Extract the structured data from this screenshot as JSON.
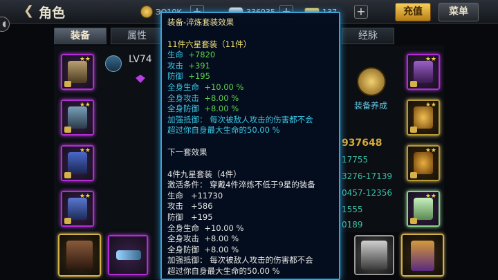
{
  "header": {
    "title": "角色",
    "currencies": [
      {
        "name": "copper-coin",
        "value": "ЭО10К"
      },
      {
        "name": "silver",
        "value": "336935"
      },
      {
        "name": "gold",
        "value": "137"
      }
    ],
    "recharge_label": "充值",
    "menu_label": "菜单"
  },
  "tabs": [
    "装备",
    "属性",
    "经脉"
  ],
  "hero": {
    "level": "LV74"
  },
  "side_panel": {
    "cultivate_label": "装备养成",
    "power": "937648",
    "stats": [
      "17755",
      "3276-17139",
      "0457-12356",
      "1555",
      "0189"
    ]
  },
  "tooltip": {
    "title": "装备-淬炼套装效果",
    "current": {
      "set_name": "11件六星套装（11件）",
      "stats": [
        {
          "label": "生命",
          "value": "+7820"
        },
        {
          "label": "攻击",
          "value": "+391"
        },
        {
          "label": "防御",
          "value": "+195"
        },
        {
          "label": "全身生命",
          "value": "+10.00 %"
        },
        {
          "label": "全身攻击",
          "value": "+8.00 %"
        },
        {
          "label": "全身防御",
          "value": "+8.00 %"
        }
      ],
      "special_label": "加强抵御：",
      "special_text_1": "每次被敌人攻击的伤害都不会",
      "special_text_2": "超过你自身最大生命的50.00 %"
    },
    "next_header": "下一套效果",
    "next": {
      "set_name": "4件九星套装（4件）",
      "condition_label": "激活条件：",
      "condition": "穿戴4件淬炼不低于9星的装备",
      "stats": [
        {
          "label": "生命",
          "value": "+11730"
        },
        {
          "label": "攻击",
          "value": "+586"
        },
        {
          "label": "防御",
          "value": "+195"
        },
        {
          "label": "全身生命",
          "value": "+10.00 %"
        },
        {
          "label": "全身攻击",
          "value": "+8.00 %"
        },
        {
          "label": "全身防御",
          "value": "+8.00 %"
        }
      ],
      "special_label": "加强抵御：",
      "special_text_1": "每次被敌人攻击的伤害都不会",
      "special_text_2": "超过你自身最大生命的50.00 %"
    }
  },
  "colors": {
    "tooltip_border": "#3da1d6",
    "epic_border": "#b42bd8",
    "gold_border": "#d2b148",
    "stat_green": "#5fd04c",
    "stat_cyan": "#3dc7e6"
  }
}
